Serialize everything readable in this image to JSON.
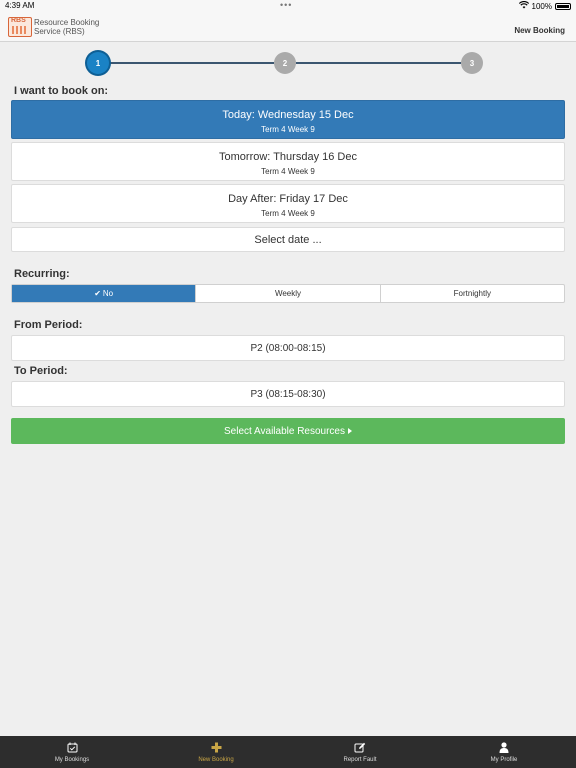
{
  "status_bar": {
    "time": "4:39 AM",
    "dots": "•••",
    "battery": "100%"
  },
  "header": {
    "logo_abbr": "RBS",
    "logo_text": "Resource Booking Service (RBS)",
    "title": "New Booking"
  },
  "stepper": {
    "steps": [
      "1",
      "2",
      "3"
    ],
    "active_step": "1"
  },
  "booking": {
    "label": "I want to book on:",
    "options": [
      {
        "main": "Today: Wednesday 15 Dec",
        "sub": "Term 4 Week 9",
        "selected": true
      },
      {
        "main": "Tomorrow: Thursday 16 Dec",
        "sub": "Term 4 Week 9",
        "selected": false
      },
      {
        "main": "Day After: Friday 17 Dec",
        "sub": "Term 4 Week 9",
        "selected": false
      }
    ],
    "select_date": "Select date ..."
  },
  "recurring": {
    "label": "Recurring:",
    "options": [
      "No",
      "Weekly",
      "Fortnightly"
    ],
    "selected": "No"
  },
  "from_period": {
    "label": "From Period:",
    "value": "P2 (08:00-08:15)"
  },
  "to_period": {
    "label": "To Period:",
    "value": "P3 (08:15-08:30)"
  },
  "cta": {
    "label": "Select Available Resources"
  },
  "tabbar": {
    "tabs": [
      {
        "label": "My Bookings",
        "icon": "calendar-check-icon"
      },
      {
        "label": "New Booking",
        "icon": "plus-icon"
      },
      {
        "label": "Report Fault",
        "icon": "edit-icon"
      },
      {
        "label": "My Profile",
        "icon": "user-icon"
      }
    ],
    "active": "New Booking"
  },
  "colors": {
    "primary": "#337ab7",
    "success": "#5cb85c",
    "step_active": "#1a82c5",
    "tab_active": "#c9a646",
    "tabbar_bg": "#2d2d2d"
  }
}
